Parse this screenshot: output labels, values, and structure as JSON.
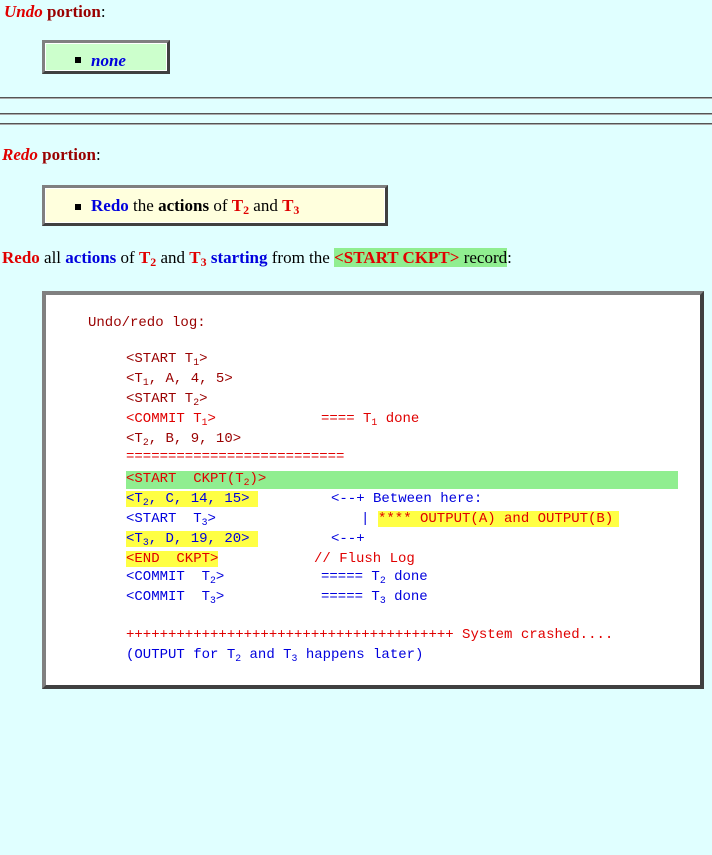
{
  "undo": {
    "heading_italic": "Undo",
    "heading_rest": " portion",
    "colon": ":",
    "item": "none"
  },
  "redo": {
    "heading_italic": "Redo",
    "heading_rest": " portion",
    "colon": ":",
    "item": {
      "w1": "Redo",
      "w2": " the ",
      "w3": "actions",
      "w4": " of ",
      "t2": "T",
      "t2sub": "2",
      "and": " and ",
      "t3": "T",
      "t3sub": "3"
    }
  },
  "sentence": {
    "w1": "Redo",
    "w2": " all ",
    "w3": "actions",
    "w4": " of ",
    "t2": "T",
    "t2sub": "2",
    "and": " and ",
    "t3": "T",
    "t3sub": "3",
    "w5": " starting",
    "w6": " from the ",
    "hl": "<START CKPT>",
    "w7": " record",
    "colon": ":"
  },
  "log": {
    "title": "Undo/redo log:",
    "l1a": "<START T",
    "l1s": "1",
    "l1b": ">",
    "l2a": "<T",
    "l2s": "1",
    "l2b": ", A, 4, 5>",
    "l3a": "<START T",
    "l3s": "2",
    "l3b": ">",
    "l4a": "<COMMIT T",
    "l4s": "1",
    "l4b": ">",
    "l4c": "==== T",
    "l4cs": "1",
    "l4d": " done",
    "l5a": "<T",
    "l5s": "2",
    "l5b": ", B, 9, 10>",
    "l6": "==========================",
    "l7a": "<START  CKPT(T",
    "l7s": "2",
    "l7b": ")>",
    "l8a": "<T",
    "l8s": "2",
    "l8b": ", C, 14, 15>",
    "l8c": "<--+ Between here:",
    "l9a": "<START  T",
    "l9s": "3",
    "l9b": ">",
    "l9c": "|",
    "l9d": "**** OUTPUT(A) and OUTPUT(B)",
    "l10a": "<T",
    "l10s": "3",
    "l10b": ", D, 19, 20>",
    "l10c": "<--+",
    "l11a": "<END  CKPT>",
    "l11c": "// Flush Log",
    "l12a": "<COMMIT  T",
    "l12s": "2",
    "l12b": ">",
    "l12c": "===== T",
    "l12cs": "2",
    "l12d": " done",
    "l13a": "<COMMIT  T",
    "l13s": "3",
    "l13b": ">",
    "l13c": "===== T",
    "l13cs": "3",
    "l13d": " done",
    "l14": "+++++++++++++++++++++++++++++++++++++++ System crashed....",
    "l15a": "(OUTPUT for T",
    "l15s": "2",
    "l15b": " and T",
    "l15s2": "3",
    "l15c": " happens later)"
  }
}
